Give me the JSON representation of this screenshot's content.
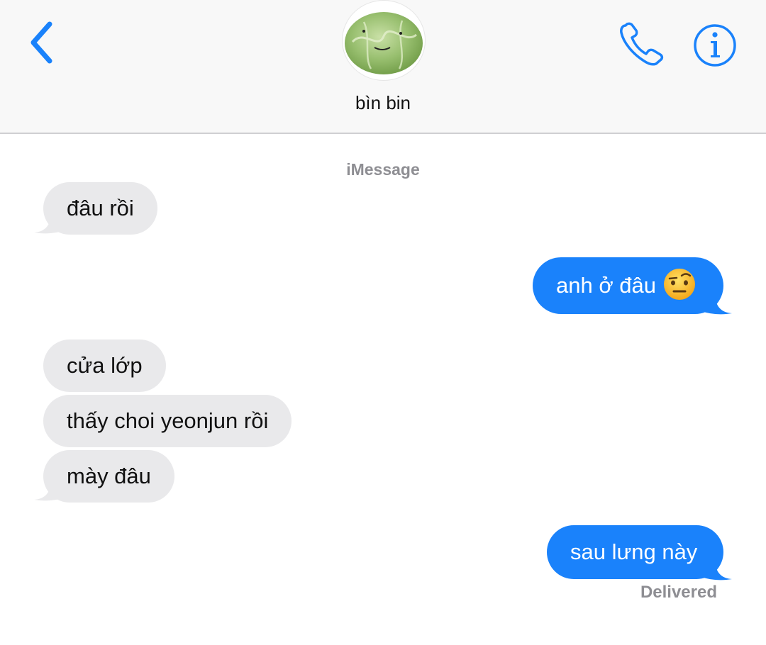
{
  "header": {
    "contact_name": "bìn bin",
    "back_icon": "chevron-left-icon",
    "call_icon": "phone-icon",
    "info_icon": "info-icon",
    "accent_color": "#1a82fb"
  },
  "conversation": {
    "service_label": "iMessage",
    "messages": [
      {
        "direction": "incoming",
        "text": "đâu rồi"
      },
      {
        "direction": "outgoing",
        "text": "anh ở đâu",
        "emoji": "face-with-raised-eyebrow"
      },
      {
        "direction": "incoming",
        "text": "cửa lớp"
      },
      {
        "direction": "incoming",
        "text": "thấy choi yeonjun rồi"
      },
      {
        "direction": "incoming",
        "text": "mày đâu"
      },
      {
        "direction": "outgoing",
        "text": "sau lưng này"
      }
    ],
    "status": "Delivered"
  }
}
